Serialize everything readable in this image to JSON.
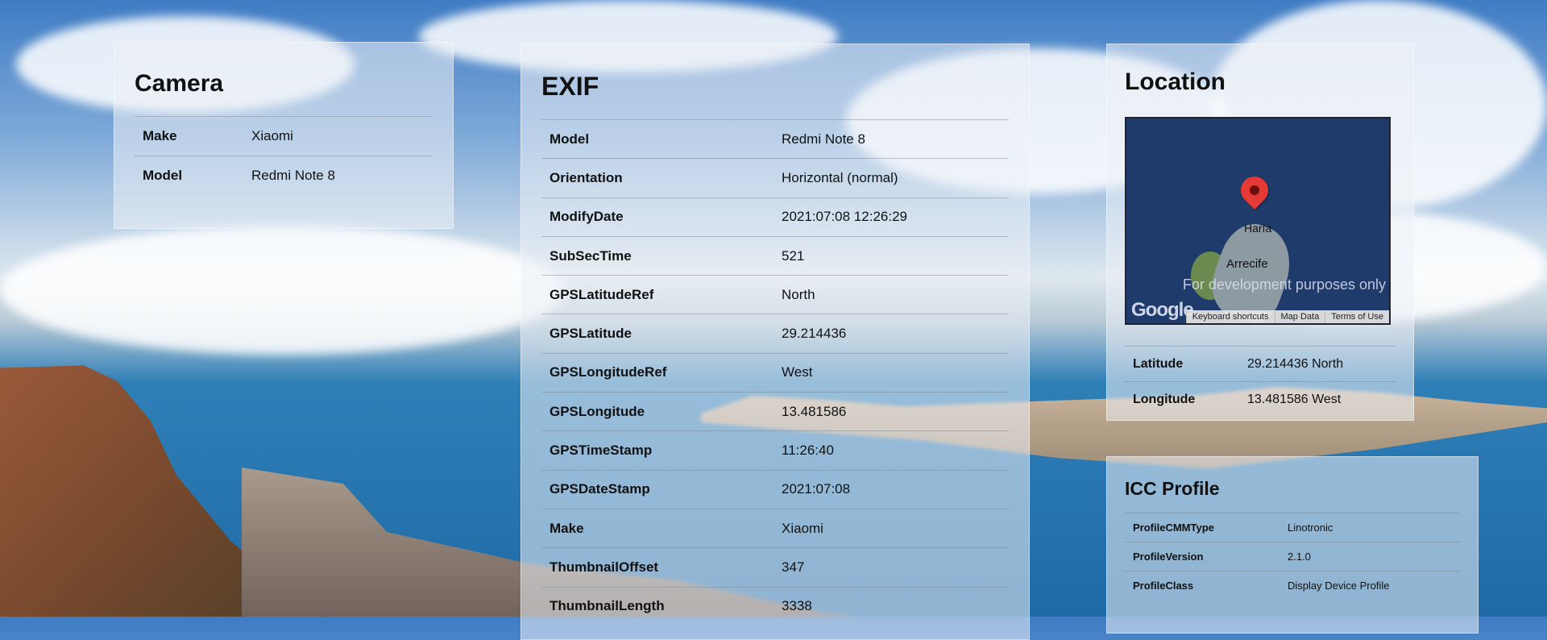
{
  "camera": {
    "title": "Camera",
    "rows": [
      {
        "key": "Make",
        "value": "Xiaomi"
      },
      {
        "key": "Model",
        "value": "Redmi Note 8"
      }
    ]
  },
  "exif": {
    "title": "EXIF",
    "rows": [
      {
        "key": "Model",
        "value": "Redmi Note 8"
      },
      {
        "key": "Orientation",
        "value": "Horizontal (normal)"
      },
      {
        "key": "ModifyDate",
        "value": "2021:07:08 12:26:29"
      },
      {
        "key": "SubSecTime",
        "value": "521"
      },
      {
        "key": "GPSLatitudeRef",
        "value": "North"
      },
      {
        "key": "GPSLatitude",
        "value": "29.214436"
      },
      {
        "key": "GPSLongitudeRef",
        "value": "West"
      },
      {
        "key": "GPSLongitude",
        "value": "13.481586"
      },
      {
        "key": "GPSTimeStamp",
        "value": "11:26:40"
      },
      {
        "key": "GPSDateStamp",
        "value": "2021:07:08"
      },
      {
        "key": "Make",
        "value": "Xiaomi"
      },
      {
        "key": "ThumbnailOffset",
        "value": "347"
      },
      {
        "key": "ThumbnailLength",
        "value": "3338"
      }
    ]
  },
  "location": {
    "title": "Location",
    "map": {
      "city_1": "Haría",
      "city_2": "Arrecife",
      "dev_notice": "For development purposes only",
      "logo": "Google",
      "footer_keyboard": "Keyboard shortcuts",
      "footer_mapdata": "Map Data",
      "footer_terms": "Terms of Use"
    },
    "rows": [
      {
        "key": "Latitude",
        "value": "29.214436 North"
      },
      {
        "key": "Longitude",
        "value": "13.481586 West"
      }
    ]
  },
  "icc": {
    "title": "ICC Profile",
    "rows": [
      {
        "key": "ProfileCMMType",
        "value": "Linotronic"
      },
      {
        "key": "ProfileVersion",
        "value": "2.1.0"
      },
      {
        "key": "ProfileClass",
        "value": "Display Device Profile"
      }
    ]
  }
}
